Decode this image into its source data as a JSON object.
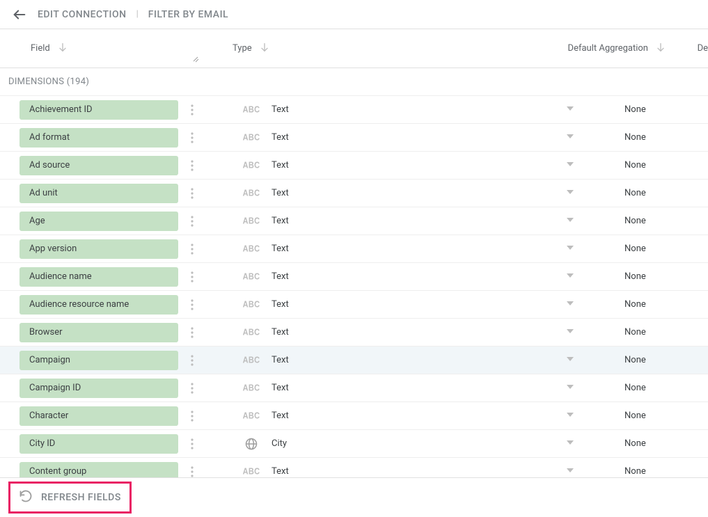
{
  "topbar": {
    "edit_connection": "EDIT CONNECTION",
    "filter_by_email": "FILTER BY EMAIL"
  },
  "headers": {
    "field": "Field",
    "type": "Type",
    "aggregation": "Default Aggregation",
    "de_partial": "De"
  },
  "section": {
    "dimensions_label": "DIMENSIONS (194)"
  },
  "rows": [
    {
      "name": "Achievement ID",
      "type_icon": "abc",
      "type": "Text",
      "agg": "None",
      "highlight": false
    },
    {
      "name": "Ad format",
      "type_icon": "abc",
      "type": "Text",
      "agg": "None",
      "highlight": false
    },
    {
      "name": "Ad source",
      "type_icon": "abc",
      "type": "Text",
      "agg": "None",
      "highlight": false
    },
    {
      "name": "Ad unit",
      "type_icon": "abc",
      "type": "Text",
      "agg": "None",
      "highlight": false
    },
    {
      "name": "Age",
      "type_icon": "abc",
      "type": "Text",
      "agg": "None",
      "highlight": false
    },
    {
      "name": "App version",
      "type_icon": "abc",
      "type": "Text",
      "agg": "None",
      "highlight": false
    },
    {
      "name": "Audience name",
      "type_icon": "abc",
      "type": "Text",
      "agg": "None",
      "highlight": false
    },
    {
      "name": "Audience resource name",
      "type_icon": "abc",
      "type": "Text",
      "agg": "None",
      "highlight": false
    },
    {
      "name": "Browser",
      "type_icon": "abc",
      "type": "Text",
      "agg": "None",
      "highlight": false
    },
    {
      "name": "Campaign",
      "type_icon": "abc",
      "type": "Text",
      "agg": "None",
      "highlight": true
    },
    {
      "name": "Campaign ID",
      "type_icon": "abc",
      "type": "Text",
      "agg": "None",
      "highlight": false
    },
    {
      "name": "Character",
      "type_icon": "abc",
      "type": "Text",
      "agg": "None",
      "highlight": false
    },
    {
      "name": "City ID",
      "type_icon": "globe",
      "type": "City",
      "agg": "None",
      "highlight": false
    },
    {
      "name": "Content group",
      "type_icon": "abc",
      "type": "Text",
      "agg": "None",
      "highlight": false
    }
  ],
  "bottom": {
    "refresh": "REFRESH FIELDS"
  }
}
